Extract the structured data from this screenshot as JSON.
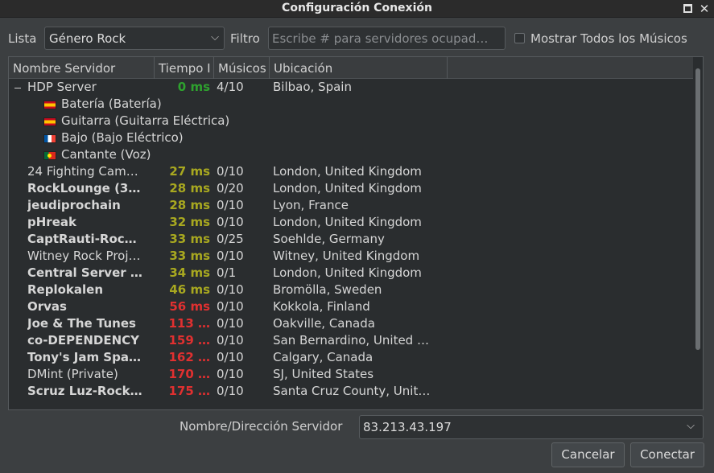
{
  "window": {
    "title": "Configuración Conexión"
  },
  "toolbar": {
    "list_label": "Lista",
    "list_value": "Género Rock",
    "filter_label": "Filtro",
    "filter_placeholder": "Escribe # para servidores ocupad…",
    "show_all_label": "Mostrar Todos los Músicos"
  },
  "table": {
    "columns": [
      "Nombre Servidor",
      "Tiempo I",
      "Músicos",
      "Ubicación"
    ],
    "expanded_server": {
      "name": "HDP Server",
      "ping": "0 ms",
      "musicians": "4/10",
      "location": "Bilbao, Spain",
      "ping_color": "#2ea22e",
      "clients": [
        {
          "flag": "spain-flag",
          "name": "Batería (Batería)"
        },
        {
          "flag": "spain-flag",
          "name": "Guitarra (Guitarra Eléctrica)"
        },
        {
          "flag": "france-flag",
          "name": "Bajo (Bajo Eléctrico)"
        },
        {
          "flag": "portugal-flag",
          "name": "Cantante (Voz)"
        }
      ]
    },
    "rows": [
      {
        "name": "24 Fighting Cam…",
        "ping": "27 ms",
        "musicians": "0/10",
        "location": "London, United Kingdom",
        "bold": false,
        "ping_color": "#a8a820"
      },
      {
        "name": "RockLounge (3…",
        "ping": "28 ms",
        "musicians": "0/20",
        "location": "London, United Kingdom",
        "bold": true,
        "ping_color": "#a8a820"
      },
      {
        "name": "jeudiprochain",
        "ping": "28 ms",
        "musicians": "0/10",
        "location": "Lyon, France",
        "bold": true,
        "ping_color": "#a8a820"
      },
      {
        "name": "pHreak",
        "ping": "32 ms",
        "musicians": "0/10",
        "location": "London, United Kingdom",
        "bold": true,
        "ping_color": "#a8a820"
      },
      {
        "name": "CaptRauti-Roc…",
        "ping": "33 ms",
        "musicians": "0/25",
        "location": "Soehlde, Germany",
        "bold": true,
        "ping_color": "#a8a820"
      },
      {
        "name": "Witney Rock Proj…",
        "ping": "33 ms",
        "musicians": "0/10",
        "location": "Witney, United Kingdom",
        "bold": false,
        "ping_color": "#a8a820"
      },
      {
        "name": "Central Server …",
        "ping": "34 ms",
        "musicians": "0/1",
        "location": "London, United Kingdom",
        "bold": true,
        "ping_color": "#a8a820"
      },
      {
        "name": "Replokalen",
        "ping": "46 ms",
        "musicians": "0/10",
        "location": "Bromölla, Sweden",
        "bold": true,
        "ping_color": "#a8a820"
      },
      {
        "name": "Orvas",
        "ping": "56 ms",
        "musicians": "0/10",
        "location": "Kokkola, Finland",
        "bold": true,
        "ping_color": "#e03030"
      },
      {
        "name": "Joe & The Tunes",
        "ping": "113 …",
        "musicians": "0/10",
        "location": "Oakville, Canada",
        "bold": true,
        "ping_color": "#e03030"
      },
      {
        "name": "co-DEPENDENCY",
        "ping": "159 …",
        "musicians": "0/10",
        "location": "San Bernardino, United …",
        "bold": true,
        "ping_color": "#e03030"
      },
      {
        "name": "Tony's Jam Spa…",
        "ping": "162 …",
        "musicians": "0/10",
        "location": "Calgary, Canada",
        "bold": true,
        "ping_color": "#e03030"
      },
      {
        "name": "DMint (Private)",
        "ping": "170 …",
        "musicians": "0/10",
        "location": "SJ, United States",
        "bold": false,
        "ping_color": "#e03030"
      },
      {
        "name": "Scruz Luz-Rock…",
        "ping": "175 …",
        "musicians": "0/10",
        "location": "Santa Cruz County, Unit…",
        "bold": true,
        "ping_color": "#e03030"
      }
    ]
  },
  "server_address": {
    "label": "Nombre/Dirección Servidor",
    "value": "83.213.43.197"
  },
  "buttons": {
    "cancel": "Cancelar",
    "connect": "Conectar"
  }
}
